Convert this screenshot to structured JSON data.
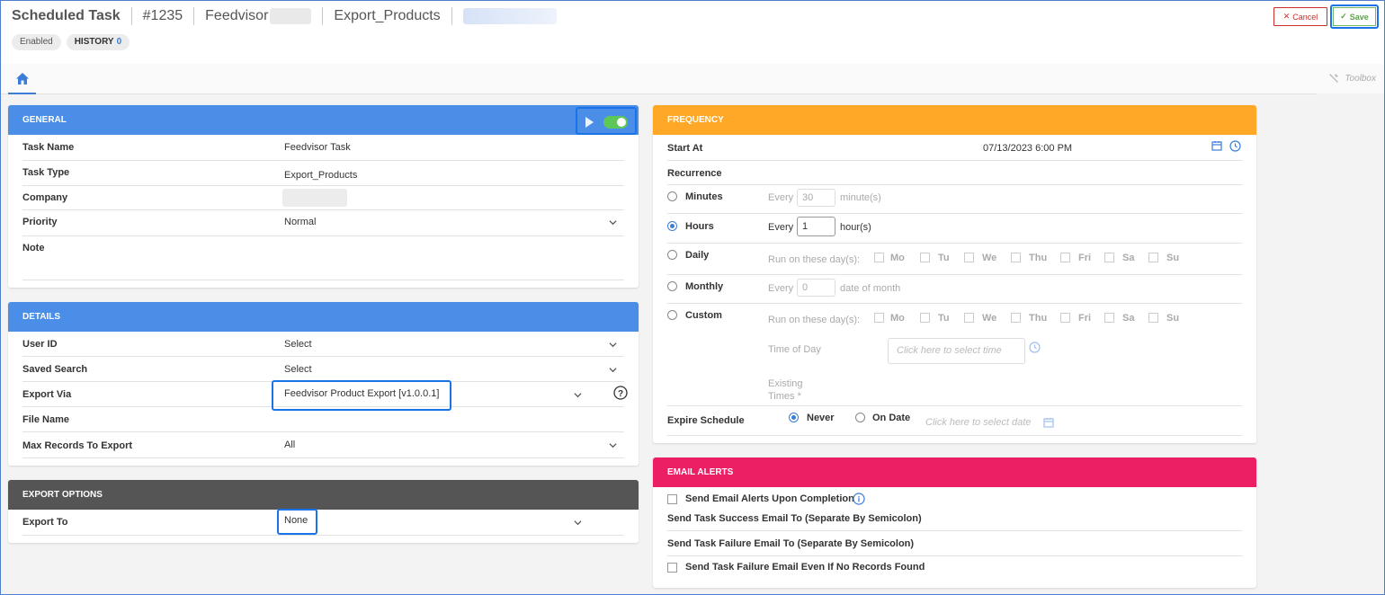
{
  "header": {
    "title": "Scheduled Task",
    "task_id": "#1235",
    "company": "Feedvisor",
    "task_type": "Export_Products",
    "status_badge": "Enabled",
    "history_label": "HISTORY",
    "history_count": "0",
    "cancel_label": "Cancel",
    "save_label": "Save",
    "toolbox_label": "Toolbox"
  },
  "general": {
    "title": "GENERAL",
    "rows": [
      {
        "label": "Task Name",
        "value": "Feedvisor Task"
      },
      {
        "label": "Task Type",
        "value": "Export_Products"
      },
      {
        "label": "Company",
        "value": ""
      },
      {
        "label": "Priority",
        "value": "Normal"
      },
      {
        "label": "Note",
        "value": ""
      }
    ],
    "enabled": true
  },
  "details": {
    "title": "DETAILS",
    "rows": [
      {
        "label": "User ID",
        "value": "Select"
      },
      {
        "label": "Saved Search",
        "value": "Select"
      },
      {
        "label": "Export Via",
        "value": "Feedvisor Product Export [v1.0.0.1]"
      },
      {
        "label": "File Name",
        "value": ""
      },
      {
        "label": "Max Records To Export",
        "value": "All"
      }
    ]
  },
  "export_options": {
    "title": "EXPORT OPTIONS",
    "export_to_label": "Export To",
    "export_to_value": "None"
  },
  "frequency": {
    "title": "FREQUENCY",
    "start_at_label": "Start At",
    "start_at_value": "07/13/2023 6:00 PM",
    "recurrence_label": "Recurrence",
    "minutes_label": "Minutes",
    "minutes_every": "Every",
    "minutes_value": "30",
    "minutes_unit": "minute(s)",
    "hours_label": "Hours",
    "hours_every": "Every",
    "hours_value": "1",
    "hours_unit": "hour(s)",
    "daily_label": "Daily",
    "run_on_days": "Run on these day(s):",
    "days": [
      "Mo",
      "Tu",
      "We",
      "Thu",
      "Fri",
      "Sa",
      "Su"
    ],
    "monthly_label": "Monthly",
    "monthly_every": "Every",
    "monthly_value": "0",
    "monthly_unit": "date of month",
    "custom_label": "Custom",
    "time_of_day_label": "Time of Day",
    "time_placeholder": "Click here to select time",
    "existing_times_label": "Existing Times *",
    "expire_label": "Expire Schedule",
    "never_label": "Never",
    "on_date_label": "On Date",
    "date_placeholder": "Click here to select date",
    "selected": "Hours"
  },
  "email_alerts": {
    "title": "EMAIL ALERTS",
    "send_on_completion": "Send Email Alerts Upon Completion",
    "success_email_label": "Send Task Success Email To (Separate By Semicolon)",
    "failure_email_label": "Send Task Failure Email To (Separate By Semicolon)",
    "failure_no_records": "Send Task Failure Email Even If No Records Found"
  },
  "colors": {
    "blue_header": "#4a8ee8",
    "dark_header": "#555555",
    "orange_header": "#ffa726",
    "pink_header": "#ec1f64",
    "highlight": "#1a73e8"
  }
}
